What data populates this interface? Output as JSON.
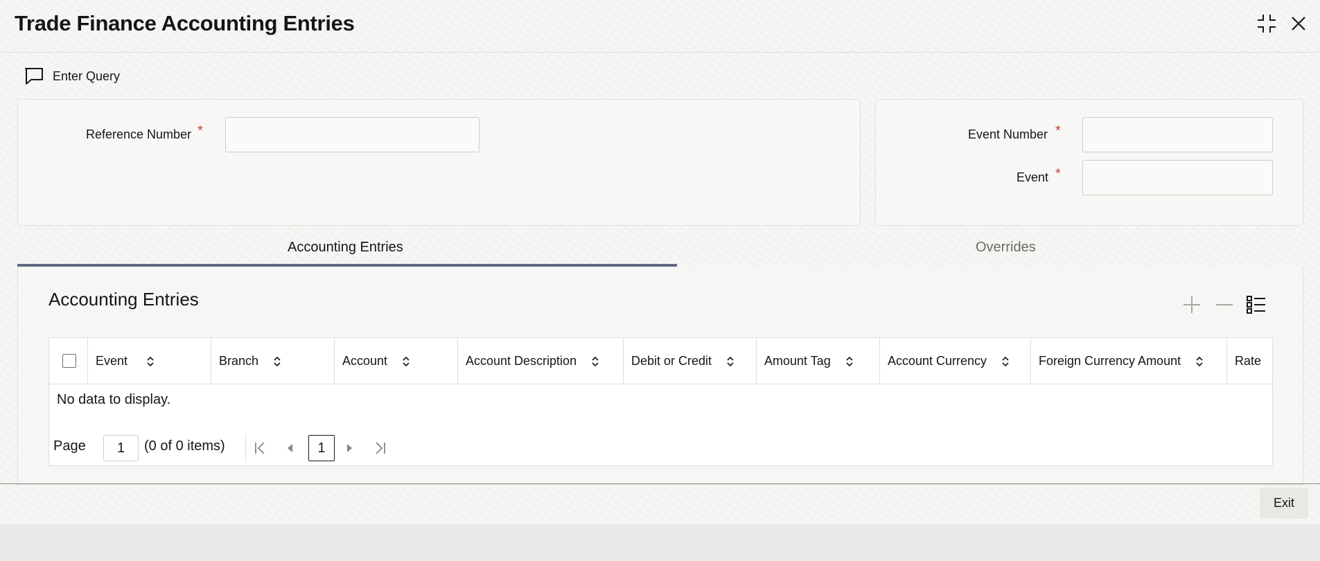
{
  "window": {
    "title": "Trade Finance Accounting Entries"
  },
  "toolbar": {
    "enter_query_label": "Enter Query"
  },
  "form": {
    "reference_number": {
      "label": "Reference Number",
      "required_mark": "*",
      "value": ""
    },
    "event_number": {
      "label": "Event Number",
      "required_mark": "*",
      "value": ""
    },
    "event": {
      "label": "Event",
      "required_mark": "*",
      "value": ""
    }
  },
  "tabs": [
    {
      "label": "Accounting Entries",
      "active": true
    },
    {
      "label": "Overrides",
      "active": false
    }
  ],
  "section": {
    "title": "Accounting Entries",
    "icons": [
      "add-icon",
      "remove-icon",
      "column-list-icon"
    ]
  },
  "grid": {
    "columns": [
      "Event",
      "Branch",
      "Account",
      "Account Description",
      "Debit or Credit",
      "Amount Tag",
      "Account Currency",
      "Foreign Currency Amount",
      "Rate"
    ],
    "rows": [],
    "empty_message": "No data to display."
  },
  "pagination": {
    "page_label": "Page",
    "page_value": "1",
    "items_text": "(0 of 0 items)",
    "current_page": "1"
  },
  "footer": {
    "exit_label": "Exit"
  },
  "colors": {
    "required": "#c74634",
    "tab_underline": "#5f6980",
    "text": "#161513"
  }
}
